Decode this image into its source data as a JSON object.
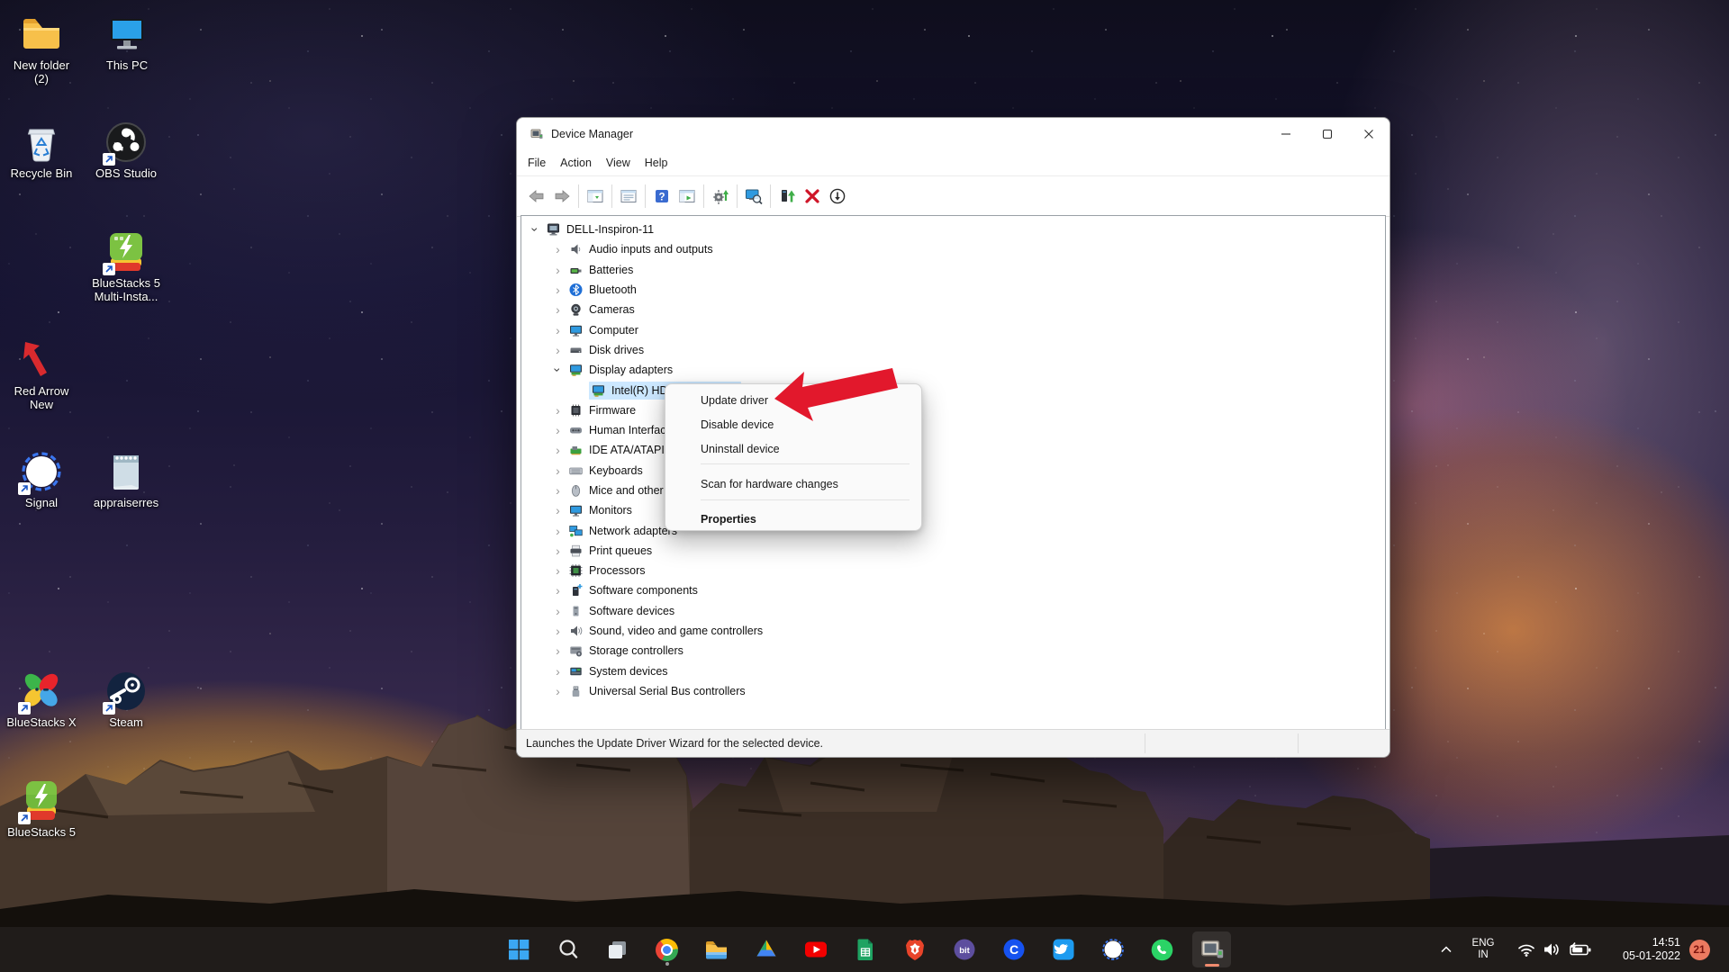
{
  "desktop": {
    "icons": [
      {
        "id": "new-folder",
        "label": "New folder",
        "label2": "(2)"
      },
      {
        "id": "this-pc",
        "label": "This PC"
      },
      {
        "id": "recycle-bin",
        "label": "Recycle Bin"
      },
      {
        "id": "obs-studio",
        "label": "OBS Studio"
      },
      {
        "id": "bluestacks5-multi",
        "label": "BlueStacks 5",
        "label2": "Multi-Insta..."
      },
      {
        "id": "red-arrow-new",
        "label": "Red Arrow",
        "label2": "New"
      },
      {
        "id": "signal",
        "label": "Signal"
      },
      {
        "id": "appraiserres",
        "label": "appraiserres"
      },
      {
        "id": "bluestacks-x",
        "label": "BlueStacks X"
      },
      {
        "id": "steam",
        "label": "Steam"
      },
      {
        "id": "bluestacks5",
        "label": "BlueStacks 5"
      }
    ]
  },
  "window": {
    "title": "Device Manager",
    "menu": [
      "File",
      "Action",
      "View",
      "Help"
    ],
    "toolbar": [
      "back",
      "forward",
      "console-tree",
      "properties",
      "help",
      "console-play",
      "gear-update",
      "scan-hardware",
      "update-driver",
      "uninstall-device",
      "disable-device"
    ],
    "statusbar": "Launches the Update Driver Wizard for the selected device.",
    "tree": [
      {
        "label": "DELL-Inspiron-11",
        "level": 0,
        "chevron": "expanded",
        "icon": "pc"
      },
      {
        "label": "Audio inputs and outputs",
        "level": 1,
        "chevron": "collapsed",
        "icon": "speaker"
      },
      {
        "label": "Batteries",
        "level": 1,
        "chevron": "collapsed",
        "icon": "battery"
      },
      {
        "label": "Bluetooth",
        "level": 1,
        "chevron": "collapsed",
        "icon": "bluetooth"
      },
      {
        "label": "Cameras",
        "level": 1,
        "chevron": "collapsed",
        "icon": "camera"
      },
      {
        "label": "Computer",
        "level": 1,
        "chevron": "collapsed",
        "icon": "monitor"
      },
      {
        "label": "Disk drives",
        "level": 1,
        "chevron": "collapsed",
        "icon": "disk"
      },
      {
        "label": "Display adapters",
        "level": 1,
        "chevron": "expanded",
        "icon": "display"
      },
      {
        "label": "Intel(R) HD Graphics 620",
        "level": 2,
        "chevron": "none",
        "icon": "display",
        "selected": true
      },
      {
        "label": "Firmware",
        "level": 1,
        "chevron": "collapsed",
        "icon": "chip"
      },
      {
        "label": "Human Interface Devices",
        "level": 1,
        "chevron": "collapsed",
        "icon": "hid"
      },
      {
        "label": "IDE ATA/ATAPI controllers",
        "level": 1,
        "chevron": "collapsed",
        "icon": "ide"
      },
      {
        "label": "Keyboards",
        "level": 1,
        "chevron": "collapsed",
        "icon": "keyboard"
      },
      {
        "label": "Mice and other pointing devices",
        "level": 1,
        "chevron": "collapsed",
        "icon": "mouse"
      },
      {
        "label": "Monitors",
        "level": 1,
        "chevron": "collapsed",
        "icon": "monitor"
      },
      {
        "label": "Network adapters",
        "level": 1,
        "chevron": "collapsed",
        "icon": "network"
      },
      {
        "label": "Print queues",
        "level": 1,
        "chevron": "collapsed",
        "icon": "printer"
      },
      {
        "label": "Processors",
        "level": 1,
        "chevron": "collapsed",
        "icon": "processor"
      },
      {
        "label": "Software components",
        "level": 1,
        "chevron": "collapsed",
        "icon": "softcomp"
      },
      {
        "label": "Software devices",
        "level": 1,
        "chevron": "collapsed",
        "icon": "softdev"
      },
      {
        "label": "Sound, video and game controllers",
        "level": 1,
        "chevron": "collapsed",
        "icon": "sound"
      },
      {
        "label": "Storage controllers",
        "level": 1,
        "chevron": "collapsed",
        "icon": "storage"
      },
      {
        "label": "System devices",
        "level": 1,
        "chevron": "collapsed",
        "icon": "sysdev"
      },
      {
        "label": "Universal Serial Bus controllers",
        "level": 1,
        "chevron": "collapsed",
        "icon": "usb"
      }
    ]
  },
  "context_menu": {
    "items": [
      {
        "label": "Update driver"
      },
      {
        "label": "Disable device"
      },
      {
        "label": "Uninstall device"
      },
      {
        "sep": true
      },
      {
        "label": "Scan for hardware changes"
      },
      {
        "sep": true
      },
      {
        "label": "Properties",
        "bold": true
      }
    ]
  },
  "annotation": {
    "arrow_color": "#e2182c"
  },
  "taskbar": {
    "items": [
      "start",
      "search",
      "task-view",
      "chrome",
      "file-explorer",
      "google-drive",
      "youtube",
      "sheets",
      "brave",
      "bitwarden",
      "coinbase",
      "twitter",
      "signal",
      "whatsapp",
      "device-manager"
    ],
    "active": "device-manager",
    "running": "chrome",
    "tray": {
      "lang_top": "ENG",
      "lang_bottom": "IN",
      "time": "14:51",
      "date": "05-01-2022",
      "badge": "21"
    }
  }
}
